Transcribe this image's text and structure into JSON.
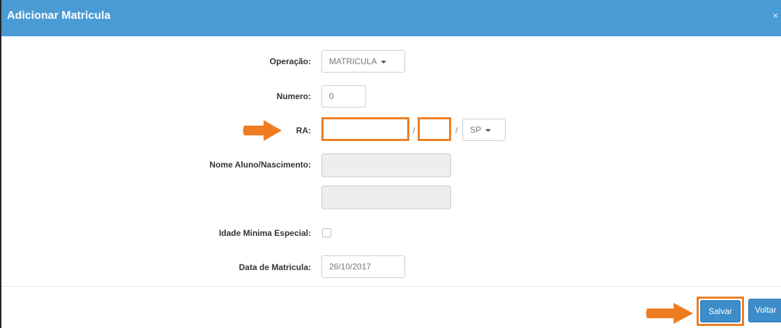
{
  "header": {
    "title": "Adicionar Matricula",
    "close": "×"
  },
  "form": {
    "operacao": {
      "label": "Operação:",
      "value": "MATRICULA"
    },
    "numero": {
      "label": "Numero:",
      "value": "0"
    },
    "ra": {
      "label": "RA:",
      "value_main": "",
      "value_digit": "",
      "slash1": "/",
      "slash2": "/",
      "uf": "SP"
    },
    "nome": {
      "label": "Nome Aluno/Nascimento:",
      "nome_value": "",
      "nascimento_value": ""
    },
    "idade": {
      "label": "Idade Minima Especial:"
    },
    "data": {
      "label": "Data de Matricula:",
      "value": "26/10/2017"
    }
  },
  "footer": {
    "save_label": "Salvar",
    "back_label": "Voltar"
  },
  "colors": {
    "header": "#4a9bd4",
    "highlight": "#ee7d21",
    "button": "#3c8dc9"
  },
  "icons": {
    "arrow": "orange-right-arrow-icon",
    "caret": "caret-down-icon"
  }
}
